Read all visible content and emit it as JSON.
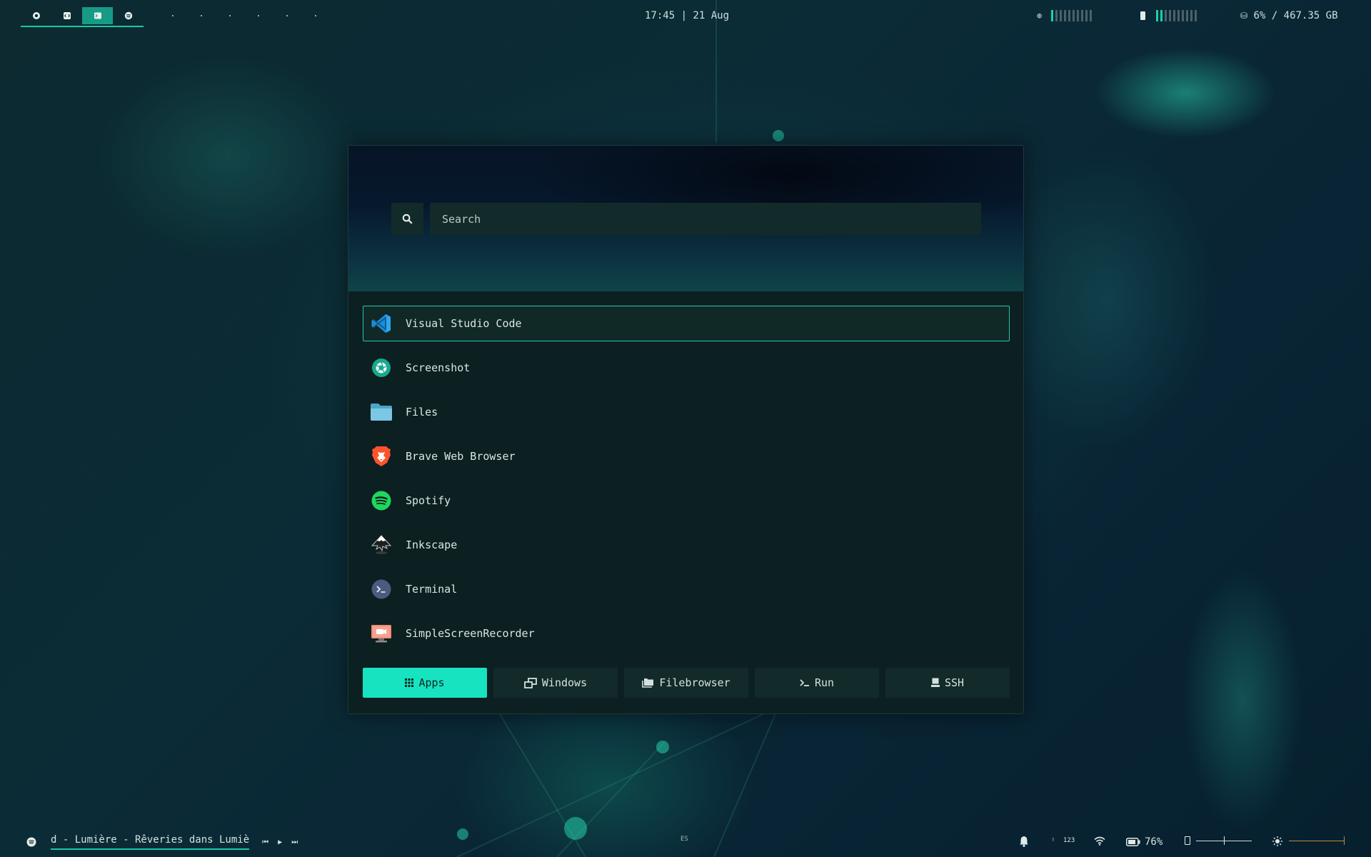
{
  "topbar": {
    "workspaces": [
      {
        "icon": "chrome-icon",
        "active": false
      },
      {
        "icon": "code-icon",
        "active": false
      },
      {
        "icon": "terminal-icon",
        "active": true
      },
      {
        "icon": "spotify-icon",
        "active": false
      }
    ],
    "empty_workspaces": [
      ".",
      ".",
      ".",
      ".",
      ".",
      "."
    ],
    "clock": "17:45 | 21 Aug",
    "cpu": {
      "icon": "cpu-icon",
      "level": 0.1
    },
    "memory": {
      "icon": "memory-icon",
      "level": 0.2
    },
    "disk": {
      "icon": "disk-icon",
      "text": "6% / 467.35 GB"
    }
  },
  "launcher": {
    "search": {
      "placeholder": "Search",
      "value": ""
    },
    "apps": [
      {
        "label": "Visual Studio Code",
        "icon": "vscode-icon",
        "selected": true
      },
      {
        "label": "Screenshot",
        "icon": "screenshot-icon",
        "selected": false
      },
      {
        "label": "Files",
        "icon": "folder-icon",
        "selected": false
      },
      {
        "label": "Brave Web Browser",
        "icon": "brave-icon",
        "selected": false
      },
      {
        "label": "Spotify",
        "icon": "spotify-icon",
        "selected": false
      },
      {
        "label": "Inkscape",
        "icon": "inkscape-icon",
        "selected": false
      },
      {
        "label": "Terminal",
        "icon": "terminal-icon",
        "selected": false
      },
      {
        "label": "SimpleScreenRecorder",
        "icon": "screen-recorder-icon",
        "selected": false
      }
    ],
    "tabs": [
      {
        "label": "Apps",
        "icon": "grid-icon",
        "active": true
      },
      {
        "label": "Windows",
        "icon": "windows-icon",
        "active": false
      },
      {
        "label": "Filebrowser",
        "icon": "folders-icon",
        "active": false
      },
      {
        "label": "Run",
        "icon": "prompt-icon",
        "active": false
      },
      {
        "label": "SSH",
        "icon": "computer-icon",
        "active": false
      }
    ]
  },
  "bottombar": {
    "now_playing": "d - Lumière - Rêveries dans Lumiè",
    "media_controls": {
      "prev": "⏮",
      "play": "▶",
      "next": "⏭"
    },
    "keyboard_layout": "ES",
    "caps": "123",
    "battery": "76%",
    "volume_level": 0.5,
    "brightness_level": 1.0,
    "colors": {
      "accent": "#17e3c0",
      "bar_accent": "#17c9a6",
      "brightness": "#c18a3c"
    }
  }
}
